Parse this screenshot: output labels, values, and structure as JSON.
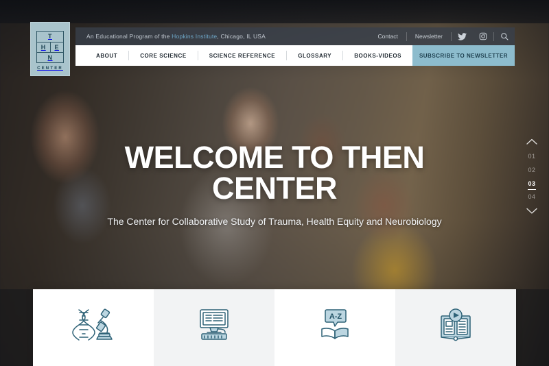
{
  "site": {
    "logo": {
      "letters": [
        "T",
        "H",
        "E",
        "N"
      ],
      "word": "CENTER"
    }
  },
  "topbar": {
    "tagline_before": "An Educational Program of the ",
    "tagline_link": "Hopkins Institute",
    "tagline_after": ", Chicago, IL USA",
    "links": [
      {
        "label": "Contact"
      },
      {
        "label": "Newsletter"
      }
    ],
    "icons": [
      {
        "name": "twitter-icon"
      },
      {
        "name": "instagram-icon"
      },
      {
        "name": "search-icon"
      }
    ]
  },
  "nav": {
    "items": [
      {
        "label": "ABOUT"
      },
      {
        "label": "CORE SCIENCE"
      },
      {
        "label": "SCIENCE REFERENCE"
      },
      {
        "label": "GLOSSARY"
      },
      {
        "label": "BOOKS-VIDEOS"
      }
    ],
    "cta_label": "SUBSCRIBE TO NEWSLETTER"
  },
  "hero": {
    "title": "WELCOME TO THEN CENTER",
    "subtitle": "The Center for Collaborative Study of Trauma, Health Equity and Neurobiology"
  },
  "slide_nav": {
    "up_label": "⌃",
    "down_label": "⌄",
    "slides": [
      {
        "label": "01",
        "active": false
      },
      {
        "label": "02",
        "active": false
      },
      {
        "label": "03",
        "active": true
      },
      {
        "label": "04",
        "active": false
      }
    ]
  },
  "cards": [
    {
      "icon": "dna-microscope-icon",
      "background": "white"
    },
    {
      "icon": "computer-monitor-icon",
      "background": "gray"
    },
    {
      "icon": "a-z-glossary-book-icon",
      "background": "white"
    },
    {
      "icon": "book-video-play-icon",
      "background": "gray"
    }
  ],
  "colors": {
    "accent_blue": "#8dbccd",
    "logo_bg": "#a9c4cc",
    "icon_stroke": "#2e6277",
    "icon_fill": "#bcd6e1",
    "topbar_bg": "#38404b",
    "nav_bg": "#ffffff"
  }
}
